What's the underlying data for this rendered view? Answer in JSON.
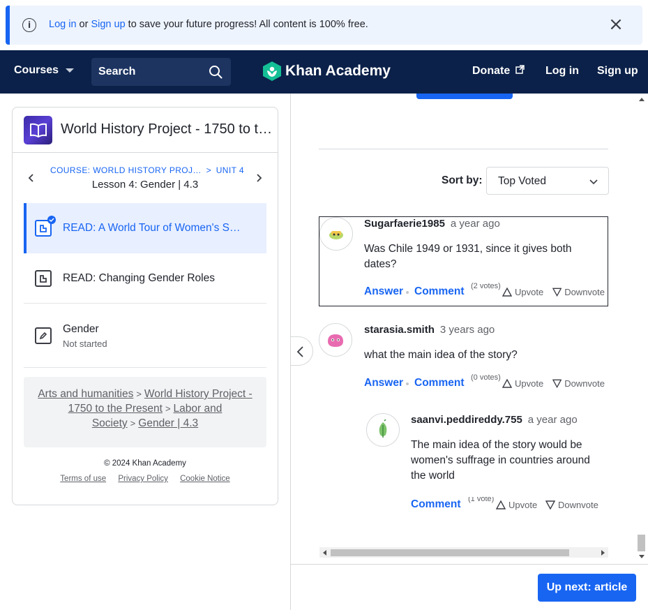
{
  "banner": {
    "login": "Log in",
    "or": " or ",
    "signup": "Sign up",
    "message": " to save your future progress! All content is 100% free.",
    "close": "×"
  },
  "header": {
    "courses": "Courses",
    "search_placeholder": "Search",
    "logo": "Khan Academy",
    "donate": "Donate",
    "login": "Log in",
    "signup": "Sign up"
  },
  "sidebar": {
    "course_title": "World History Project - 1750 to t…",
    "crumb_course": "COURSE: WORLD HISTORY PROJ…",
    "crumb_sep": ">",
    "crumb_unit": "UNIT 4",
    "lesson_title": "Lesson 4: Gender | 4.3",
    "items": [
      {
        "label": "READ: A World Tour of Women's S…",
        "sub": ""
      },
      {
        "label": "READ: Changing Gender Roles",
        "sub": ""
      },
      {
        "label": "Gender",
        "sub": "Not started"
      }
    ],
    "breadcrumbs": [
      "Arts and humanities",
      "World History Project - 1750 to the Present",
      "Labor and Society",
      "Gender | 4.3"
    ],
    "copyright": "© 2024 Khan Academy",
    "footer_links": [
      "Terms of use",
      "Privacy Policy",
      "Cookie Notice"
    ]
  },
  "discussion": {
    "sort_label": "Sort by:",
    "sort_value": "Top Voted",
    "comments": [
      {
        "author": "Sugarfaerie1985",
        "time": "a year ago",
        "body": "Was Chile 1949 or 1931, since it gives both dates?",
        "answer": "Answer",
        "comment": "Comment",
        "votes": "(2 votes)",
        "upvote": "Upvote",
        "downvote": "Downvote"
      },
      {
        "author": "starasia.smith",
        "time": "3 years ago",
        "body": "what the main idea of the story?",
        "answer": "Answer",
        "comment": "Comment",
        "votes": "(0 votes)",
        "upvote": "Upvote",
        "downvote": "Downvote"
      },
      {
        "author": "saanvi.peddireddy.755",
        "time": "a year ago",
        "body": "The main idea of the story would be women's suffrage in countries around the world",
        "comment": "Comment",
        "votes": "(1 vote)",
        "upvote": "Upvote",
        "downvote": "Downvote"
      }
    ],
    "up_next": "Up next: article"
  },
  "colors": {
    "brand": "#1865f2",
    "header_bg": "#0b2149",
    "logo_green": "#14bf96"
  }
}
